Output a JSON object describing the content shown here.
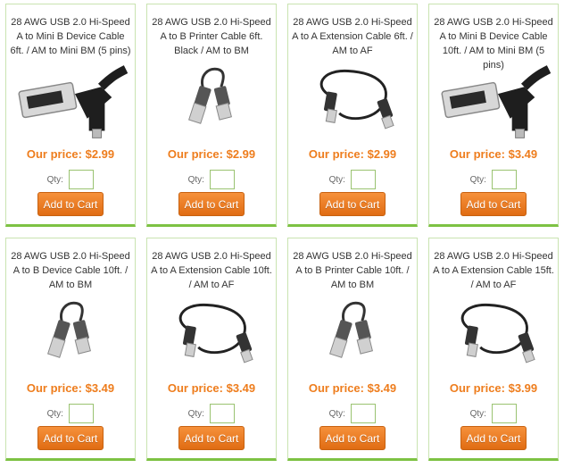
{
  "products": [
    {
      "title": "28 AWG USB 2.0 Hi-Speed A to Mini B Device Cable 6ft. / AM to Mini BM (5 pins)",
      "price": "Our price: $2.99",
      "image": "usb-a-to-mini-b-closeup",
      "qty_label": "Qty:",
      "qty_value": "",
      "cart_label": "Add to Cart"
    },
    {
      "title": "28 AWG USB 2.0 Hi-Speed A to B Printer Cable 6ft. Black / AM to BM",
      "price": "Our price: $2.99",
      "image": "usb-a-to-b-cable",
      "qty_label": "Qty:",
      "qty_value": "",
      "cart_label": "Add to Cart"
    },
    {
      "title": "28 AWG USB 2.0 Hi-Speed A to A Extension Cable 6ft. / AM to AF",
      "price": "Our price: $2.99",
      "image": "usb-extension-coil",
      "qty_label": "Qty:",
      "qty_value": "",
      "cart_label": "Add to Cart"
    },
    {
      "title": "28 AWG USB 2.0 Hi-Speed A to Mini B Device Cable 10ft. / AM to Mini BM (5 pins)",
      "price": "Our price: $3.49",
      "image": "usb-a-to-mini-b-closeup",
      "qty_label": "Qty:",
      "qty_value": "",
      "cart_label": "Add to Cart"
    },
    {
      "title": "28 AWG USB 2.0 Hi-Speed A to B Device Cable 10ft. / AM to BM",
      "price": "Our price: $3.49",
      "image": "usb-a-to-b-cable",
      "qty_label": "Qty:",
      "qty_value": "",
      "cart_label": "Add to Cart"
    },
    {
      "title": "28 AWG USB 2.0 Hi-Speed A to A Extension Cable 10ft. / AM to AF",
      "price": "Our price: $3.49",
      "image": "usb-extension-coil",
      "qty_label": "Qty:",
      "qty_value": "",
      "cart_label": "Add to Cart"
    },
    {
      "title": "28 AWG USB 2.0 Hi-Speed A to B Printer Cable 10ft. / AM to BM",
      "price": "Our price: $3.49",
      "image": "usb-a-to-b-cable",
      "qty_label": "Qty:",
      "qty_value": "",
      "cart_label": "Add to Cart"
    },
    {
      "title": "28 AWG USB 2.0 Hi-Speed A to A Extension Cable 15ft. / AM to AF",
      "price": "Our price: $3.99",
      "image": "usb-extension-coil",
      "qty_label": "Qty:",
      "qty_value": "",
      "cart_label": "Add to Cart"
    }
  ],
  "colors": {
    "accent_green": "#7dc243",
    "price_orange": "#ee7d1d",
    "button_orange": "#f08321"
  }
}
